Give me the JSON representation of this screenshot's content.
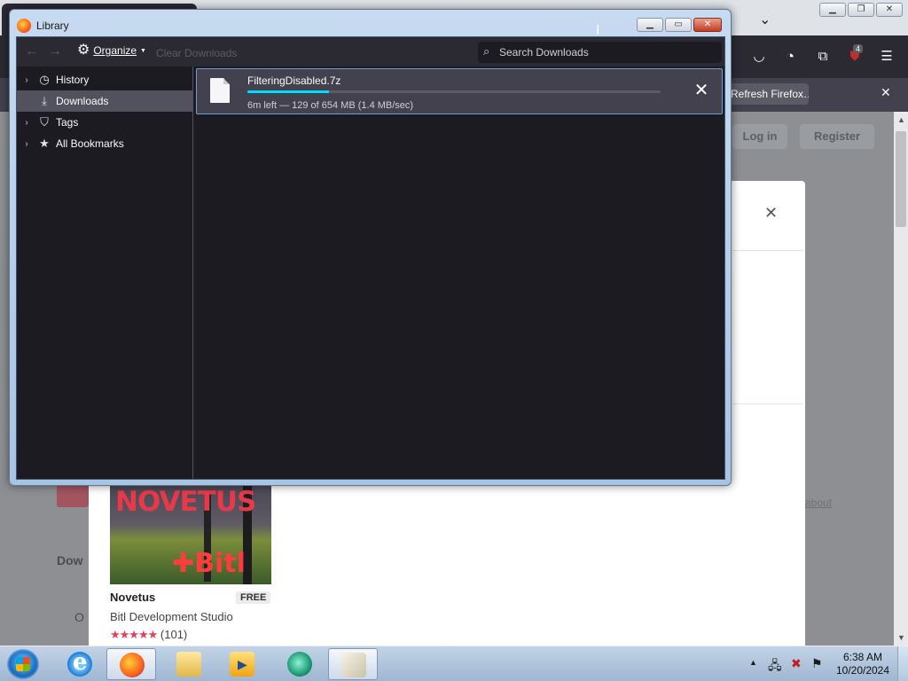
{
  "library": {
    "title": "Library",
    "toolbar": {
      "organize_label": "Organize",
      "clear_downloads_label": "Clear Downloads",
      "search_placeholder": "Search Downloads",
      "search_value": ""
    },
    "sidebar": {
      "items": [
        {
          "label": "History",
          "icon": "clock-icon",
          "expandable": true,
          "selected": false
        },
        {
          "label": "Downloads",
          "icon": "download-icon",
          "expandable": false,
          "selected": true
        },
        {
          "label": "Tags",
          "icon": "tag-icon",
          "expandable": true,
          "selected": false
        },
        {
          "label": "All Bookmarks",
          "icon": "star-icon",
          "expandable": true,
          "selected": false
        }
      ]
    },
    "downloads": [
      {
        "filename": "FilteringDisabled.7z",
        "status": "6m left — 129 of 654 MB (1.4 MB/sec)",
        "progress_fraction": 0.197
      }
    ]
  },
  "background": {
    "notification_button_label": "Refresh Firefox…",
    "toolbar_badge": "4",
    "login_label": "Log in",
    "register_label": "Register",
    "game_card": {
      "thumbnail_title": "NOVETUS",
      "thumbnail_logo": "Bitl",
      "name": "Novetus",
      "price_badge": "FREE",
      "developer": "Bitl Development Studio",
      "stars": "★★★★★",
      "rating_count": "(101)"
    }
  },
  "taskbar": {
    "time": "6:38 AM",
    "date": "10/20/2024",
    "apps": [
      "internet-explorer-icon",
      "firefox-icon",
      "folder-icon",
      "media-player-icon",
      "app-icon",
      "paint-icon"
    ]
  },
  "colors": {
    "firefox_dark_bg": "#1c1b22",
    "firefox_toolbar": "#2b2a33",
    "download_item_bg": "#42414d",
    "progress_accent": "#00ddff",
    "selection_border": "#6f9fd8"
  }
}
